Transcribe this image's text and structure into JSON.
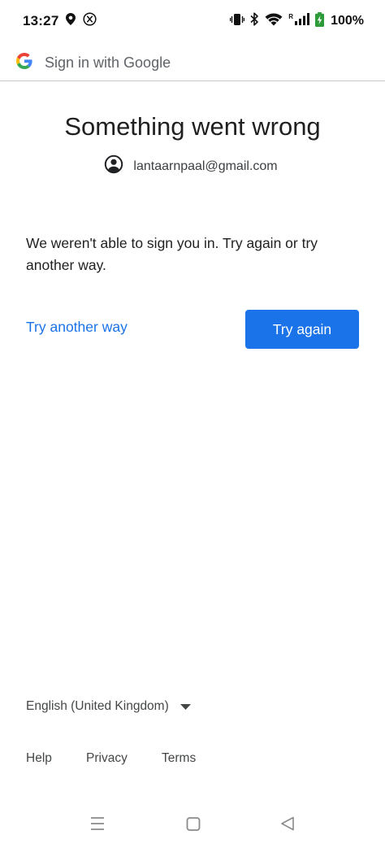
{
  "status_bar": {
    "time": "13:27",
    "roaming_label": "R",
    "battery_percent": "100%",
    "icons": [
      "location-icon",
      "x-app-icon",
      "vibrate-icon",
      "bluetooth-icon",
      "wifi-icon",
      "signal-icon",
      "battery-charging-icon"
    ]
  },
  "header": {
    "title": "Sign in with Google",
    "logo": "google-logo"
  },
  "main": {
    "title": "Something went wrong",
    "account_email": "lantaarnpaal@gmail.com",
    "message": "We weren't able to sign you in. Try again or try another way.",
    "try_another_way_label": "Try another way",
    "try_again_label": "Try again"
  },
  "footer": {
    "language": "English (United Kingdom)",
    "links": [
      "Help",
      "Privacy",
      "Terms"
    ]
  },
  "nav_bar": {
    "buttons": [
      "menu-icon",
      "home-icon",
      "back-icon"
    ]
  },
  "colors": {
    "accent": "#1a73e8",
    "text_primary": "#1f1f1f",
    "text_secondary": "#444746",
    "divider": "#c4c7c5"
  }
}
